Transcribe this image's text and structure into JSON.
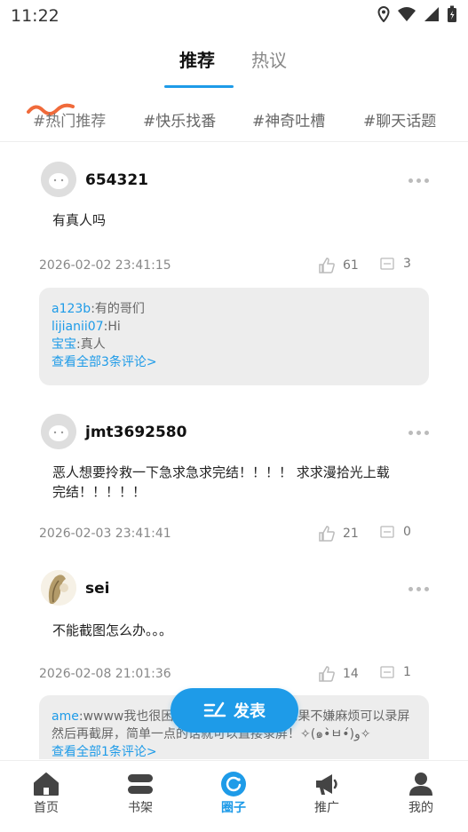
{
  "status_bar": {
    "time": "11:22"
  },
  "header": {
    "tabs": [
      {
        "label": "推荐",
        "active": true
      },
      {
        "label": "热议",
        "active": false
      }
    ],
    "accent_color": "#1e9be8"
  },
  "topics": [
    "#热门推荐",
    "#快乐找番",
    "#神奇吐槽",
    "#聊天话题"
  ],
  "posts": [
    {
      "username": "654321",
      "content": "有真人吗",
      "date": "2026-02-02 23:41:15",
      "likes": "61",
      "comments": "3",
      "comment_preview": [
        {
          "name": "a123b",
          "sep": ":",
          "text": "有的哥们"
        },
        {
          "name": "lijianii07",
          "sep": ":",
          "text": "Hi"
        },
        {
          "name": "宝宝",
          "sep": ":",
          "text": "真人"
        }
      ],
      "view_all": "查看全部3条评论>"
    },
    {
      "username": "jmt3692580",
      "content": "恶人想要拎救一下急求急求完结！！！！ 求求漫拾光上载完结！！！！！",
      "date": "2026-02-03 23:41:41",
      "likes": "21",
      "comments": "0"
    },
    {
      "username": "sei",
      "content": "不能截图怎么办。。。",
      "date": "2026-02-08 21:01:36",
      "likes": "14",
      "comments": "1",
      "comment_preview": [
        {
          "name": "ame",
          "sep": ":",
          "text": "wwww我也很困扰，发现这个问题，如果不嫌麻烦可以录屏然后再截屏，简单一点的话就可以直接录屏！✧(๑•̀ㅂ•́)و✧"
        }
      ],
      "view_all": "查看全部1条评论>"
    }
  ],
  "publish_button": {
    "label": "发表"
  },
  "bottom_nav": [
    {
      "label": "首页",
      "icon": "home-icon",
      "active": false
    },
    {
      "label": "书架",
      "icon": "bookshelf-icon",
      "active": false
    },
    {
      "label": "圈子",
      "icon": "circle-icon",
      "active": true
    },
    {
      "label": "推广",
      "icon": "megaphone-icon",
      "active": false
    },
    {
      "label": "我的",
      "icon": "profile-icon",
      "active": false
    }
  ]
}
